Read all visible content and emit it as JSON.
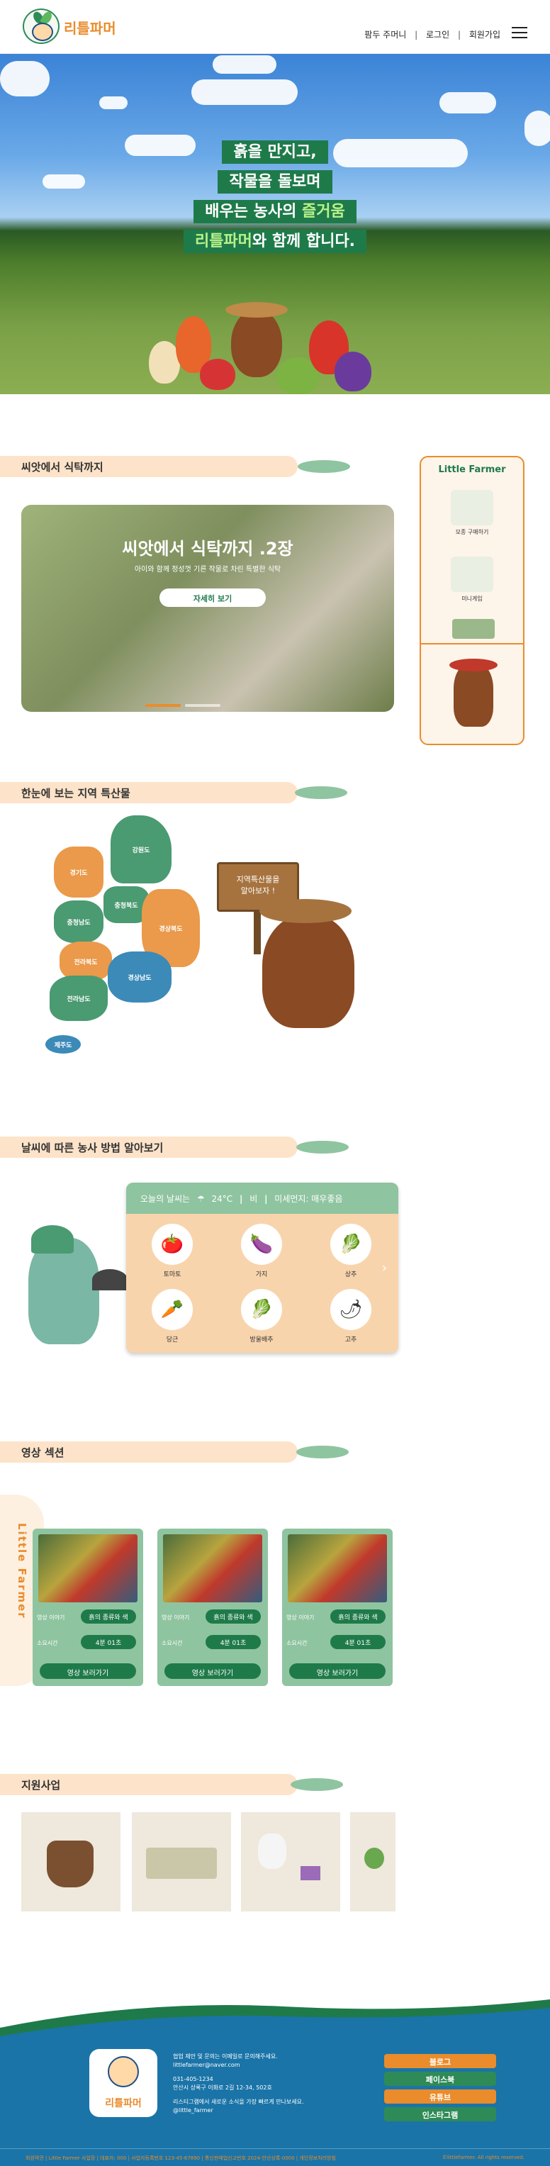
{
  "header": {
    "logo_text": "리틀파머",
    "nav": [
      "팜두 주머니",
      "로그인",
      "회원가입"
    ],
    "menu_icon": "hamburger-icon"
  },
  "hero": {
    "line1": "흙을 만지고,",
    "line2": "작물을 돌보며",
    "line3a": "배우는 농사의 ",
    "line3b": "즐거움",
    "line4a": "리틀파머",
    "line4b": "와 함께 합니다."
  },
  "section1": {
    "title": "씨앗에서 식탁까지",
    "card_title": "씨앗에서 식탁까지 .2장",
    "card_sub": "아이와 함께 정성껏 기른 작물로 차린 특별한 식탁",
    "card_button": "자세히 보기"
  },
  "side_panel": {
    "title": "Little Farmer",
    "items": [
      "모종 구매하기",
      "미니게임"
    ]
  },
  "section2": {
    "title": "한눈에 보는 지역 특산물",
    "regions": [
      "강원도",
      "경기도",
      "충청북도",
      "충청남도",
      "경상북도",
      "전라북도",
      "경상남도",
      "전라남도",
      "제주도"
    ],
    "sign": [
      "지역특산물을",
      "알아보자 !"
    ]
  },
  "section3": {
    "title": "날씨에 따른 농사 방법 알아보기",
    "weather_label": "오늘의 날씨는",
    "temp": "24°C",
    "condition": "비",
    "dust": "미세먼지: 매우좋음",
    "vegetables": [
      {
        "name": "토마토",
        "icon": "🍅"
      },
      {
        "name": "가지",
        "icon": "🍆"
      },
      {
        "name": "상추",
        "icon": "🥬"
      },
      {
        "name": "당근",
        "icon": "🥕"
      },
      {
        "name": "방울배추",
        "icon": "🥬"
      },
      {
        "name": "고추",
        "icon": "🌶"
      }
    ],
    "next_icon": "›"
  },
  "section4": {
    "title": "영상 섹션",
    "tab": "Little Farmer",
    "videos": [
      {
        "label": "영상 이야기",
        "tag": "흙의 종류와 색",
        "time_label": "소요시간",
        "time": "4분 01초",
        "watch": "영상 보러가기"
      },
      {
        "label": "영상 이야기",
        "tag": "흙의 종류와 색",
        "time_label": "소요시간",
        "time": "4분 01초",
        "watch": "영상 보러가기"
      },
      {
        "label": "영상 이야기",
        "tag": "흙의 종류와 색",
        "time_label": "소요시간",
        "time": "4분 01초",
        "watch": "영상 보러가기"
      }
    ]
  },
  "section5": {
    "title": "지원사업"
  },
  "footer": {
    "logo_text": "리틀파머",
    "info": [
      "협업 제안 및 문의는 이메일로 문의해주세요.",
      "littlefarmer@naver.com",
      "",
      "031-405-1234",
      "안산시 상록구 이화로 2길 12-34, 502호",
      "",
      "리스티그램에서 새로운 소식을 가장 빠르게 만나보세요.",
      "@little_farmer"
    ],
    "sns": [
      "블로그",
      "페이스북",
      "유튜브",
      "인스타그램"
    ],
    "copyright_left": "회원약관 | Little Farmer 사업장 | 대표자: 000 | 사업자등록번호 123-45-67890 | 통신판매업신고번호 2024-안산상록-0000 | 개인정보처리방침",
    "copyright_right": "©littlefarmer. All rights reserved."
  }
}
